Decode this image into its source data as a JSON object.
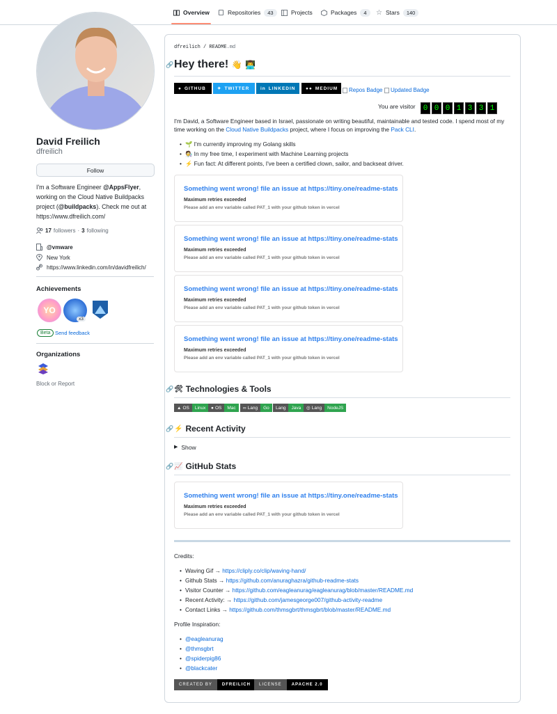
{
  "nav": {
    "tabs": [
      {
        "label": "Overview",
        "count": null,
        "icon": "book-icon"
      },
      {
        "label": "Repositories",
        "count": "43",
        "icon": "repo-icon"
      },
      {
        "label": "Projects",
        "count": null,
        "icon": "project-icon"
      },
      {
        "label": "Packages",
        "count": "4",
        "icon": "package-icon"
      },
      {
        "label": "Stars",
        "count": "140",
        "icon": "star-icon"
      }
    ],
    "active_color": "#fd8c73"
  },
  "profile": {
    "name": "David Freilich",
    "login": "dfreilich",
    "follow_label": "Follow",
    "bio_1": "I'm a Software Engineer ",
    "bio_company": "@AppsFlyer",
    "bio_2": ", working on the Cloud Native Buildpacks project (",
    "bio_project": "@buildpacks",
    "bio_3": "). Check me out at https://www.dfreilich.com/",
    "followers_count": "17",
    "followers_label": "followers",
    "following_count": "3",
    "following_label": "following",
    "org": "@vmware",
    "location": "New York",
    "website": "https://www.linkedin.com/in/davidfreilich/"
  },
  "sidebar": {
    "achievements_title": "Achievements",
    "achievement_multiplier": "x3",
    "beta_label": "Beta",
    "feedback_label": "Send feedback",
    "organizations_title": "Organizations",
    "block_label": "Block or Report"
  },
  "readme": {
    "crumb_user": "dfreilich",
    "crumb_sep": " / ",
    "crumb_file": "README",
    "crumb_ext": ".md",
    "title": "Hey there!",
    "social_badges": [
      {
        "label": "GITHUB",
        "color": "#000000"
      },
      {
        "label": "TWITTER",
        "color": "#1da1f2"
      },
      {
        "label": "LINKEDIN",
        "color": "#0077b5"
      },
      {
        "label": "MEDIUM",
        "color": "#000000"
      }
    ],
    "broken_images": [
      "Repos Badge",
      "Updated Badge"
    ],
    "visitor_label": "You are visitor",
    "visitor_digits": [
      "0",
      "0",
      "0",
      "1",
      "3",
      "3",
      "1"
    ],
    "intro_1": "I'm David, a Software Engineer based in Israel, passionate on writing beautiful, maintainable and tested code. I spend most of my time working on the ",
    "intro_link1": "Cloud Native Buildpacks",
    "intro_2": " project, where I focus on improving the ",
    "intro_link2": "Pack CLI",
    "intro_3": ".",
    "bullets": [
      "🌱 I'm currently improving my Golang skills",
      "🧑‍🔬 In my free time, I experiment with Machine Learning projects",
      "⚡ Fun fact: At different points, I've been a certified clown, sailor, and backseat driver."
    ],
    "error_card": {
      "title": "Something went wrong! file an issue at https://tiny.one/readme-stats",
      "sub1": "Maximum retries exceeded",
      "sub2": "Please add an env variable called PAT_1 with your github token in vercel"
    },
    "tech_title": "Technologies & Tools",
    "tech_emoji": "🛠",
    "tech_badges": [
      {
        "left": "OS",
        "right": "Linux",
        "color": "#2fa44f"
      },
      {
        "left": "OS",
        "right": "Mac",
        "color": "#2fa44f"
      },
      {
        "left": "Lang",
        "right": "Go",
        "color": "#2fa44f"
      },
      {
        "left": "Lang",
        "right": "Java",
        "color": "#2fa44f"
      },
      {
        "left": "Lang",
        "right": "NodeJS",
        "color": "#2fa44f"
      }
    ],
    "activity_title": "Recent Activity",
    "activity_emoji": "⚡",
    "show_label": "Show",
    "stats_title": "GitHub Stats",
    "stats_emoji": "📈",
    "credits_label": "Credits:",
    "credits": [
      {
        "label": "Waving Gif → ",
        "link": "https://cliply.co/clip/waving-hand/"
      },
      {
        "label": "Github Stats → ",
        "link": "https://github.com/anuraghazra/github-readme-stats"
      },
      {
        "label": "Visitor Counter → ",
        "link": "https://github.com/eagleanurag/eagleanurag/blob/master/README.md"
      },
      {
        "label": "Recent Activity: → ",
        "link": "https://github.com/jamesgeorge007/github-activity-readme"
      },
      {
        "label": "Contact Links → ",
        "link": "https://github.com/thmsgbrt/thmsgbrt/blob/master/README.md"
      }
    ],
    "inspiration_label": "Profile Inspiration:",
    "inspirations": [
      "@eagleanurag",
      "@thmsgbrt",
      "@spiderpig86",
      "@blackcater"
    ],
    "footer_badges": [
      {
        "left": "CREATED BY",
        "right": "DFREILICH"
      },
      {
        "left": "LICENSE",
        "right": "APACHE 2.0"
      }
    ]
  }
}
